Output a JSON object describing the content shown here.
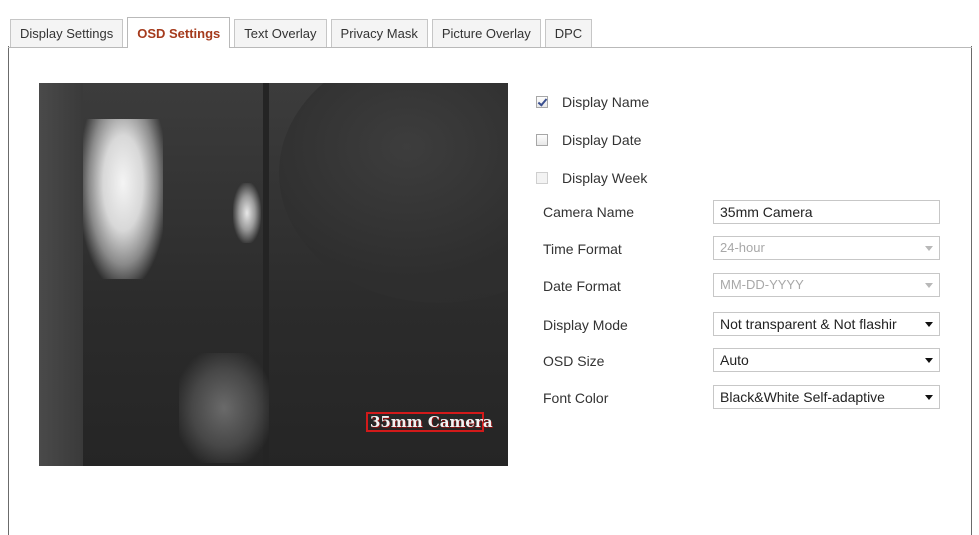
{
  "tabs": [
    {
      "label": "Display Settings",
      "active": false
    },
    {
      "label": "OSD Settings",
      "active": true
    },
    {
      "label": "Text Overlay",
      "active": false
    },
    {
      "label": "Privacy Mask",
      "active": false
    },
    {
      "label": "Picture Overlay",
      "active": false
    },
    {
      "label": "DPC",
      "active": false
    }
  ],
  "preview": {
    "osd_text": "35mm Camera"
  },
  "checkboxes": {
    "display_name": {
      "label": "Display Name",
      "checked": true
    },
    "display_date": {
      "label": "Display Date",
      "checked": false
    },
    "display_week": {
      "label": "Display Week",
      "checked": false,
      "disabled": true
    }
  },
  "fields": {
    "camera_name": {
      "label": "Camera Name",
      "value": "35mm Camera"
    },
    "time_format": {
      "label": "Time Format",
      "value": "24-hour",
      "disabled": true
    },
    "date_format": {
      "label": "Date Format",
      "value": "MM-DD-YYYY",
      "disabled": true
    },
    "display_mode": {
      "label": "Display Mode",
      "value": "Not transparent & Not flashir"
    },
    "osd_size": {
      "label": "OSD Size",
      "value": "Auto"
    },
    "font_color": {
      "label": "Font Color",
      "value": "Black&White Self-adaptive"
    }
  },
  "colors": {
    "active_tab_text": "#a53a1c",
    "osd_box_border": "#d21a1a",
    "checkbox_mark": "#3a4f8f"
  }
}
